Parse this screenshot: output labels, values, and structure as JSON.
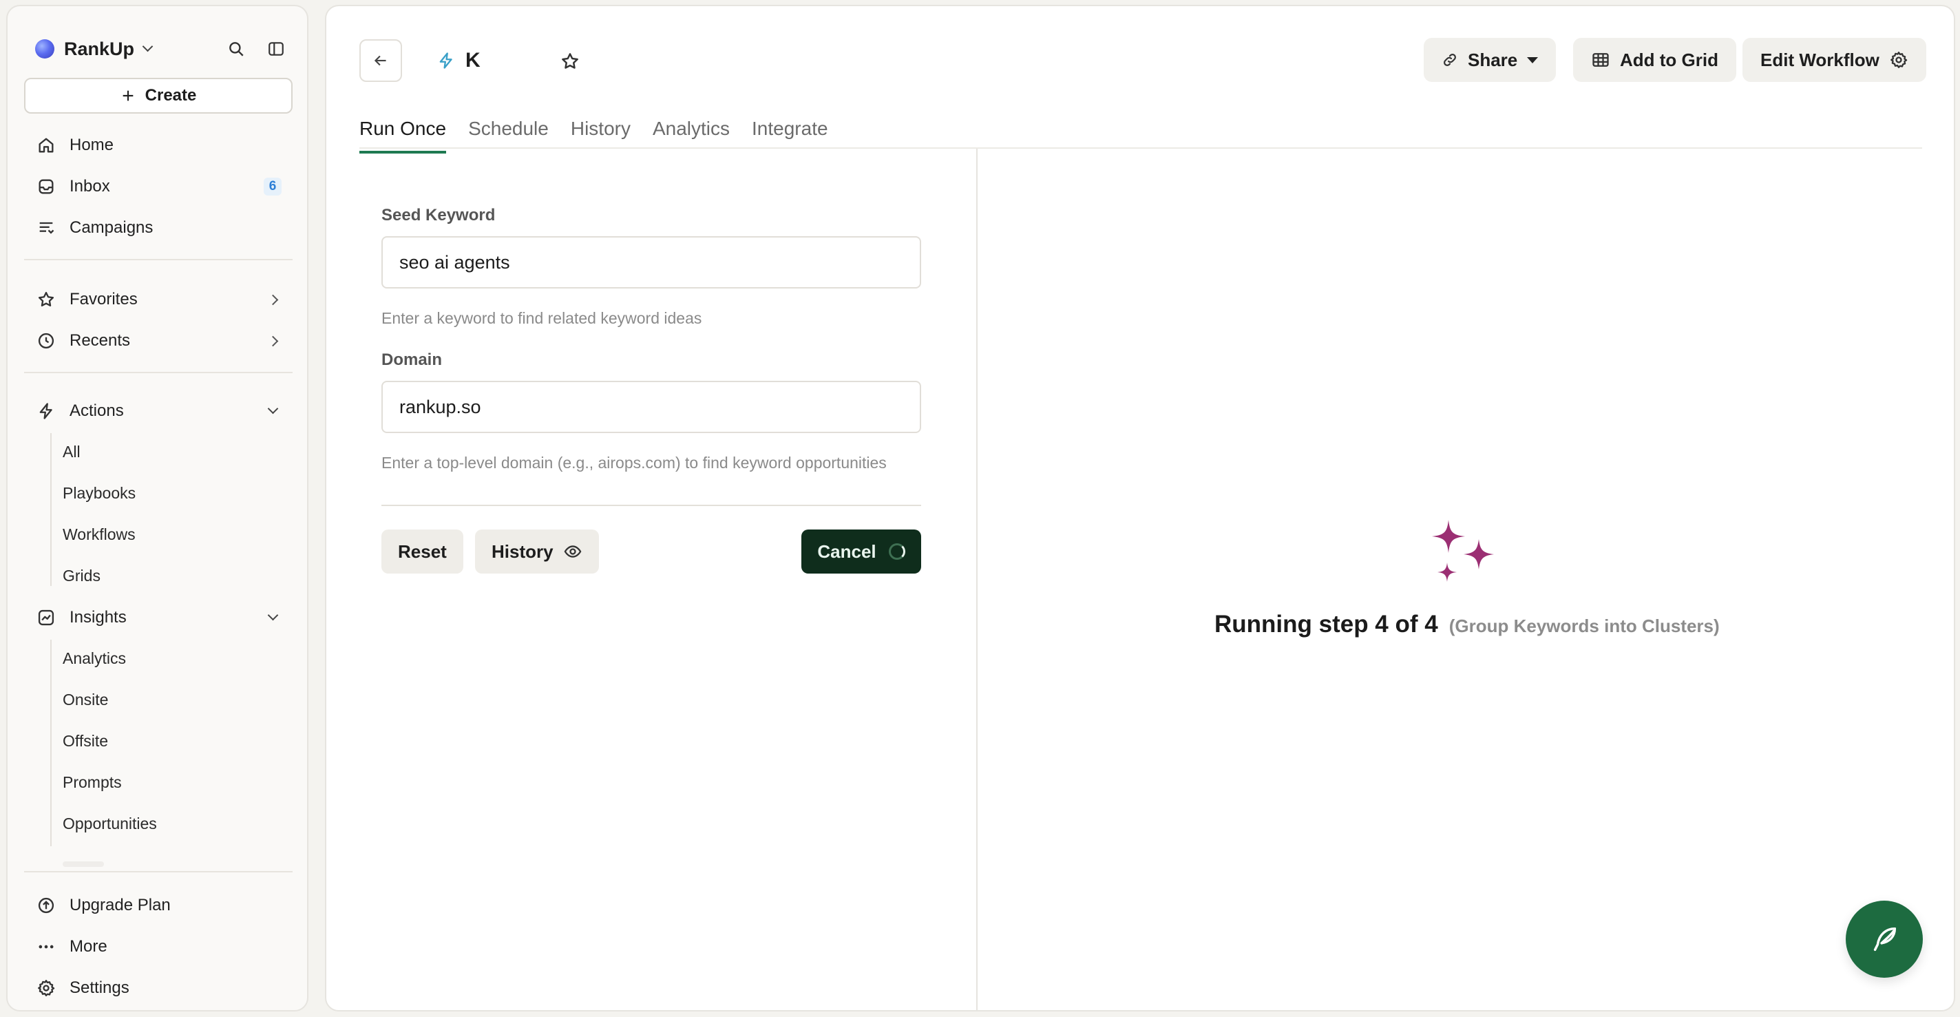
{
  "sidebar": {
    "brand": "RankUp",
    "create_label": "Create",
    "nav": {
      "home": "Home",
      "inbox": "Inbox",
      "inbox_count": "6",
      "campaigns": "Campaigns",
      "favorites": "Favorites",
      "recents": "Recents",
      "actions": "Actions",
      "insights": "Insights"
    },
    "actions_items": [
      "All",
      "Playbooks",
      "Workflows",
      "Grids"
    ],
    "insights_items": [
      "Analytics",
      "Onsite",
      "Offsite",
      "Prompts",
      "Opportunities"
    ],
    "bottom": {
      "upgrade": "Upgrade Plan",
      "more": "More",
      "settings": "Settings"
    }
  },
  "header": {
    "title": "K",
    "share_label": "Share",
    "add_to_grid_label": "Add to Grid",
    "edit_workflow_label": "Edit Workflow"
  },
  "tabs": [
    "Run Once",
    "Schedule",
    "History",
    "Analytics",
    "Integrate"
  ],
  "form": {
    "seed_keyword": {
      "label": "Seed Keyword",
      "value": "seo ai agents",
      "help": "Enter a keyword to find related keyword ideas"
    },
    "domain": {
      "label": "Domain",
      "value": "rankup.so",
      "help": "Enter a top-level domain (e.g., airops.com) to find keyword opportunities"
    },
    "reset_label": "Reset",
    "history_label": "History",
    "cancel_label": "Cancel"
  },
  "status": {
    "main": "Running step 4 of 4",
    "detail": "(Group Keywords into Clusters)"
  },
  "colors": {
    "accent_green": "#1e7a52",
    "cancel_bg": "#0f2d1c",
    "sparkle": "#9b2f73",
    "fab_bg": "#1d6b40"
  }
}
